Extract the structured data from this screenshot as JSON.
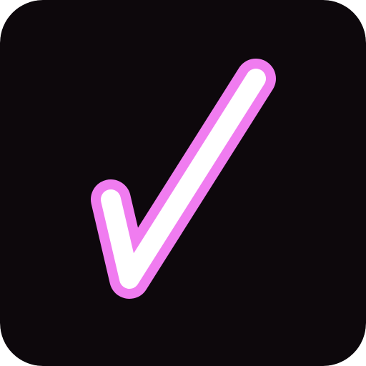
{
  "icon": {
    "glyph": "check-mark-icon",
    "colors": {
      "background": "#0d080c",
      "outline": "#f07cf0",
      "stroke": "#ffffff"
    }
  }
}
